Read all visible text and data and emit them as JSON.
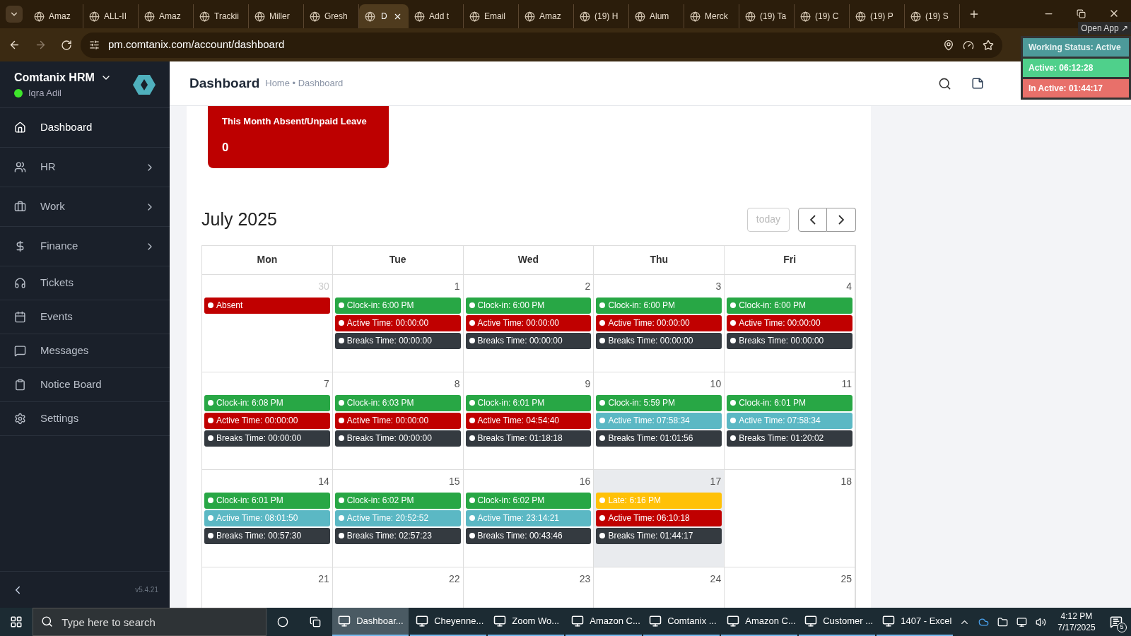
{
  "browser": {
    "tabs": [
      {
        "label": "Amaz",
        "selected": false
      },
      {
        "label": "ALL-II",
        "selected": false
      },
      {
        "label": "Amaz",
        "selected": false
      },
      {
        "label": "Trackii",
        "selected": false
      },
      {
        "label": "Miller",
        "selected": false
      },
      {
        "label": "Gresh",
        "selected": false
      },
      {
        "label": "D",
        "selected": true
      },
      {
        "label": "Add t",
        "selected": false
      },
      {
        "label": "Email",
        "selected": false
      },
      {
        "label": "Amaz",
        "selected": false
      },
      {
        "label": "(19) H",
        "selected": false
      },
      {
        "label": "Alum",
        "selected": false
      },
      {
        "label": "Merck",
        "selected": false
      },
      {
        "label": "(19) Ta",
        "selected": false
      },
      {
        "label": "(19) C",
        "selected": false
      },
      {
        "label": "(19) P",
        "selected": false
      },
      {
        "label": "(19) S",
        "selected": false
      }
    ],
    "url": "pm.comtanix.com/account/dashboard"
  },
  "status_widget": {
    "open_app": "Open App ↗",
    "working_status": "Working Status: Active",
    "active": "Active: 06:12:28",
    "inactive": "In Active: 01:44:17"
  },
  "sidebar": {
    "brand": "Comtanix HRM",
    "user": "Iqra Adil",
    "online": true,
    "items": [
      {
        "label": "Dashboard",
        "selected": true,
        "expandable": false
      },
      {
        "label": "HR",
        "selected": false,
        "expandable": true
      },
      {
        "label": "Work",
        "selected": false,
        "expandable": true
      },
      {
        "label": "Finance",
        "selected": false,
        "expandable": true
      },
      {
        "label": "Tickets",
        "selected": false,
        "expandable": false
      },
      {
        "label": "Events",
        "selected": false,
        "expandable": false
      },
      {
        "label": "Messages",
        "selected": false,
        "expandable": false
      },
      {
        "label": "Notice Board",
        "selected": false,
        "expandable": false
      },
      {
        "label": "Settings",
        "selected": false,
        "expandable": false
      }
    ],
    "version": "v5.4.21"
  },
  "header": {
    "title": "Dashboard",
    "breadcrumb": "Home • Dashboard"
  },
  "absent_card": {
    "title": "This Month Absent/Unpaid Leave",
    "value": "0"
  },
  "calendar": {
    "title": "July 2025",
    "today_button": {
      "label": "today",
      "disabled": true
    },
    "weekdays": [
      "Mon",
      "Tue",
      "Wed",
      "Thu",
      "Fri"
    ],
    "weeks": [
      {
        "days": [
          {
            "day": "30",
            "other_month": true,
            "today": false,
            "events": [
              {
                "text": "Absent",
                "color": "#c00000"
              }
            ]
          },
          {
            "day": "1",
            "other_month": false,
            "today": false,
            "events": [
              {
                "text": "Clock-in: 6:00 PM",
                "color": "#28a745"
              },
              {
                "text": "Active Time: 00:00:00",
                "color": "#c00000"
              },
              {
                "text": "Breaks Time: 00:00:00",
                "color": "#343a40"
              }
            ]
          },
          {
            "day": "2",
            "other_month": false,
            "today": false,
            "events": [
              {
                "text": "Clock-in: 6:00 PM",
                "color": "#28a745"
              },
              {
                "text": "Active Time: 00:00:00",
                "color": "#c00000"
              },
              {
                "text": "Breaks Time: 00:00:00",
                "color": "#343a40"
              }
            ]
          },
          {
            "day": "3",
            "other_month": false,
            "today": false,
            "events": [
              {
                "text": "Clock-in: 6:00 PM",
                "color": "#28a745"
              },
              {
                "text": "Active Time: 00:00:00",
                "color": "#c00000"
              },
              {
                "text": "Breaks Time: 00:00:00",
                "color": "#343a40"
              }
            ]
          },
          {
            "day": "4",
            "other_month": false,
            "today": false,
            "events": [
              {
                "text": "Clock-in: 6:00 PM",
                "color": "#28a745"
              },
              {
                "text": "Active Time: 00:00:00",
                "color": "#c00000"
              },
              {
                "text": "Breaks Time: 00:00:00",
                "color": "#343a40"
              }
            ]
          }
        ]
      },
      {
        "days": [
          {
            "day": "7",
            "other_month": false,
            "today": false,
            "events": [
              {
                "text": "Clock-in: 6:08 PM",
                "color": "#28a745"
              },
              {
                "text": "Active Time: 00:00:00",
                "color": "#c00000"
              },
              {
                "text": "Breaks Time: 00:00:00",
                "color": "#343a40"
              }
            ]
          },
          {
            "day": "8",
            "other_month": false,
            "today": false,
            "events": [
              {
                "text": "Clock-in: 6:03 PM",
                "color": "#28a745"
              },
              {
                "text": "Active Time: 00:00:00",
                "color": "#c00000"
              },
              {
                "text": "Breaks Time: 00:00:00",
                "color": "#343a40"
              }
            ]
          },
          {
            "day": "9",
            "other_month": false,
            "today": false,
            "events": [
              {
                "text": "Clock-in: 6:01 PM",
                "color": "#28a745"
              },
              {
                "text": "Active Time: 04:54:40",
                "color": "#c00000"
              },
              {
                "text": "Breaks Time: 01:18:18",
                "color": "#343a40"
              }
            ]
          },
          {
            "day": "10",
            "other_month": false,
            "today": false,
            "events": [
              {
                "text": "Clock-in: 5:59 PM",
                "color": "#28a745"
              },
              {
                "text": "Active Time: 07:58:34",
                "color": "#5bb8c4"
              },
              {
                "text": "Breaks Time: 01:01:56",
                "color": "#343a40"
              }
            ]
          },
          {
            "day": "11",
            "other_month": false,
            "today": false,
            "events": [
              {
                "text": "Clock-in: 6:01 PM",
                "color": "#28a745"
              },
              {
                "text": "Active Time: 07:58:34",
                "color": "#5bb8c4"
              },
              {
                "text": "Breaks Time: 01:20:02",
                "color": "#343a40"
              }
            ]
          }
        ]
      },
      {
        "days": [
          {
            "day": "14",
            "other_month": false,
            "today": false,
            "events": [
              {
                "text": "Clock-in: 6:01 PM",
                "color": "#28a745"
              },
              {
                "text": "Active Time: 08:01:50",
                "color": "#5bb8c4"
              },
              {
                "text": "Breaks Time: 00:57:30",
                "color": "#343a40"
              }
            ]
          },
          {
            "day": "15",
            "other_month": false,
            "today": false,
            "events": [
              {
                "text": "Clock-in: 6:02 PM",
                "color": "#28a745"
              },
              {
                "text": "Active Time: 20:52:52",
                "color": "#5bb8c4"
              },
              {
                "text": "Breaks Time: 02:57:23",
                "color": "#343a40"
              }
            ]
          },
          {
            "day": "16",
            "other_month": false,
            "today": false,
            "events": [
              {
                "text": "Clock-in: 6:02 PM",
                "color": "#28a745"
              },
              {
                "text": "Active Time: 23:14:21",
                "color": "#5bb8c4"
              },
              {
                "text": "Breaks Time: 00:43:46",
                "color": "#343a40"
              }
            ]
          },
          {
            "day": "17",
            "other_month": false,
            "today": true,
            "events": [
              {
                "text": "Late: 6:16 PM",
                "color": "#ffc107"
              },
              {
                "text": "Active Time: 06:10:18",
                "color": "#c00000"
              },
              {
                "text": "Breaks Time: 01:44:17",
                "color": "#343a40"
              }
            ]
          },
          {
            "day": "18",
            "other_month": false,
            "today": false
          }
        ]
      },
      {
        "days": [
          {
            "day": "21",
            "other_month": false,
            "today": false
          },
          {
            "day": "22",
            "other_month": false,
            "today": false
          },
          {
            "day": "23",
            "other_month": false,
            "today": false
          },
          {
            "day": "24",
            "other_month": false,
            "today": false
          },
          {
            "day": "25",
            "other_month": false,
            "today": false
          }
        ]
      }
    ]
  },
  "taskbar": {
    "search_placeholder": "Type here to search",
    "apps": [
      {
        "label": "Dashboar...",
        "selected": true
      },
      {
        "label": "Cheyenne...",
        "selected": false
      },
      {
        "label": "Zoom Wo...",
        "selected": false
      },
      {
        "label": "Amazon C...",
        "selected": false
      },
      {
        "label": "Comtanix ...",
        "selected": false
      },
      {
        "label": "Amazon C...",
        "selected": false
      },
      {
        "label": "Customer ...",
        "selected": false
      },
      {
        "label": "1407 - Excel",
        "selected": false
      }
    ],
    "time": "4:12 PM",
    "date": "7/17/2025",
    "notification_count": "5"
  }
}
